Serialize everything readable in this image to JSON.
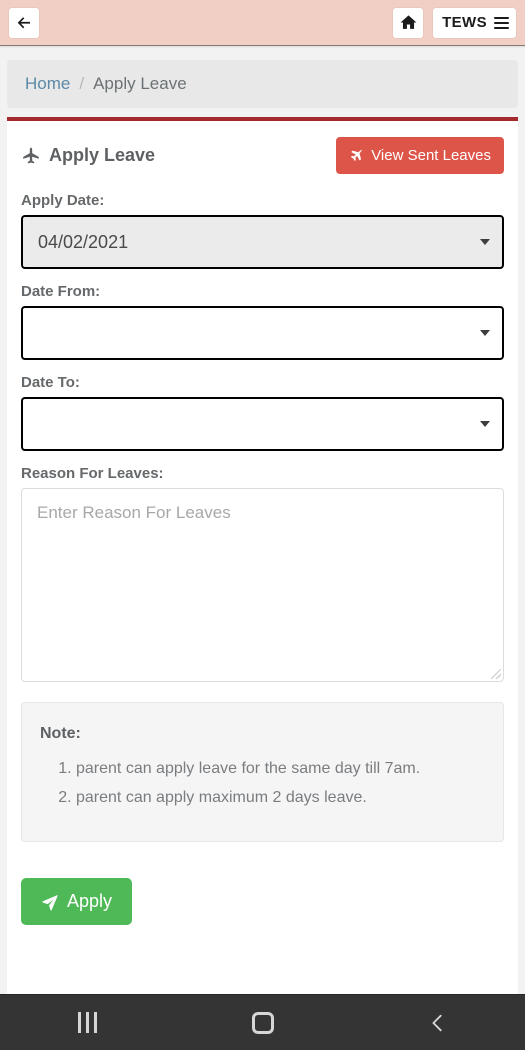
{
  "topbar": {
    "back_icon": "arrow-left-icon",
    "home_icon": "home-icon",
    "brand_label": "TEWS",
    "menu_icon": "hamburger-menu-icon",
    "background_color": "#f2cfc4"
  },
  "breadcrumb": {
    "home_label": "Home",
    "separator": "/",
    "current_label": "Apply Leave"
  },
  "card": {
    "accent_color": "#a42a2e",
    "title": "Apply Leave",
    "title_icon": "plane-up-icon",
    "view_sent_button": {
      "label": "View Sent Leaves",
      "icon": "plane-send-icon",
      "color": "#dd5549"
    }
  },
  "form": {
    "apply_date": {
      "label": "Apply Date:",
      "value": "04/02/2021",
      "disabled": true,
      "caret_icon": "chevron-down-icon"
    },
    "date_from": {
      "label": "Date From:",
      "value": "",
      "caret_icon": "chevron-down-icon"
    },
    "date_to": {
      "label": "Date To:",
      "value": "",
      "caret_icon": "chevron-down-icon"
    },
    "reason": {
      "label": "Reason For Leaves:",
      "placeholder": "Enter Reason For Leaves",
      "value": ""
    }
  },
  "note": {
    "title": "Note:",
    "items": [
      "parent can apply leave for the same day till 7am.",
      "parent can apply maximum 2 days leave."
    ]
  },
  "apply_button": {
    "label": "Apply",
    "icon": "paper-plane-icon",
    "color": "#4fb958"
  },
  "navbar": {
    "recents_icon": "recents-icon",
    "home_icon": "home-square-icon",
    "back_icon": "chevron-left-icon",
    "background_color": "#343434"
  }
}
